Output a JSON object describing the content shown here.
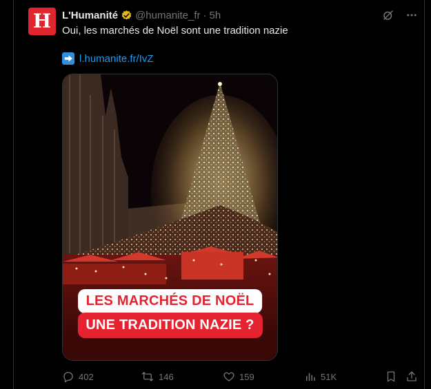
{
  "post": {
    "avatar_letter": "H",
    "author_name": "L'Humanité",
    "handle": "@humanite_fr",
    "separator": "·",
    "time": "5h",
    "text": "Oui, les marchés de Noël sont une tradition nazie",
    "link_text": "l.humanite.fr/IvZ",
    "media": {
      "caption_line1": "LES MARCHÉS DE NOËL",
      "caption_line2": "UNE TRADITION NAZIE ?"
    }
  },
  "actions": {
    "replies": "402",
    "reposts": "146",
    "likes": "159",
    "views": "51K"
  },
  "colors": {
    "background": "#000000",
    "accent_link": "#1d9bf0",
    "muted": "#71767b",
    "brand_red": "#e52330"
  },
  "icons": {
    "verified": "verified-badge-icon",
    "grok": "grok-icon",
    "more": "more-icon",
    "link_emoji": "right-arrow-emoji-icon",
    "reply": "reply-icon",
    "repost": "repost-icon",
    "like": "heart-icon",
    "views": "views-icon",
    "bookmark": "bookmark-icon",
    "share": "share-icon"
  }
}
